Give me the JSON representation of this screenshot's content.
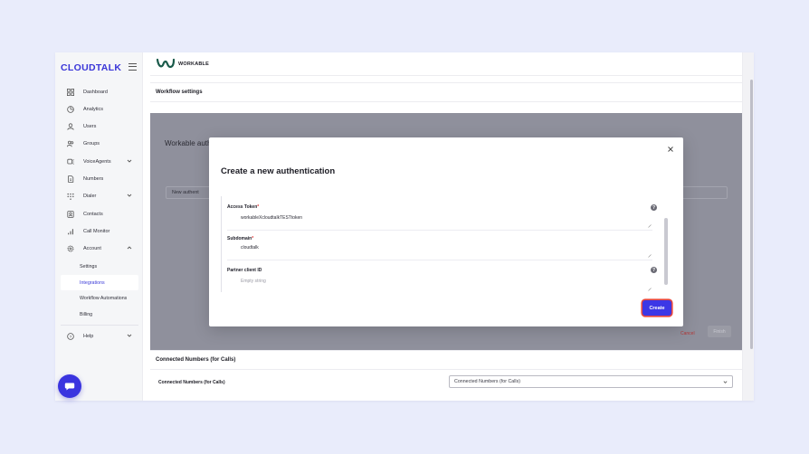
{
  "sidebar": {
    "logo": "CLOUDTALK",
    "items": [
      {
        "label": "Dashboard",
        "icon": "grid-icon"
      },
      {
        "label": "Analytics",
        "icon": "pie-chart-icon"
      },
      {
        "label": "Users",
        "icon": "user-icon"
      },
      {
        "label": "Groups",
        "icon": "users-icon"
      },
      {
        "label": "VoiceAgents",
        "icon": "voice-agent-icon",
        "expandable": true
      },
      {
        "label": "Numbers",
        "icon": "number-doc-icon"
      },
      {
        "label": "Dialer",
        "icon": "dialpad-icon",
        "expandable": true
      },
      {
        "label": "Contacts",
        "icon": "contact-card-icon"
      },
      {
        "label": "Call Monitor",
        "icon": "bar-chart-icon"
      },
      {
        "label": "Account",
        "icon": "gear-icon",
        "expanded": true
      }
    ],
    "account_sub": [
      "Settings",
      "Integrations",
      "Workflow Automations",
      "Billing"
    ],
    "active_sub": "Integrations",
    "help": "Help"
  },
  "main": {
    "integration_name": "WORKABLE",
    "workflow_settings": "Workflow settings",
    "background_heading": "Workable auth",
    "background_select": "New authent",
    "cancel": "Cancel",
    "finish": "Finish",
    "connected_section": "Connected Numbers (for Calls)",
    "connected_label": "Connected Numbers (for Calls)",
    "connected_select": "Connected Numbers (for Calls)"
  },
  "modal": {
    "title": "Create a new authentication",
    "fields": [
      {
        "label": "Access Token",
        "required": "*",
        "value": "workableXcloudtalkTESTtoken"
      },
      {
        "label": "Subdomain",
        "required": "*",
        "value": "cloudtalk"
      },
      {
        "label": "Partner client ID",
        "required": "",
        "placeholder": "Empty string"
      }
    ],
    "help_glyph": "?",
    "create": "Create"
  },
  "colors": {
    "brand": "#3a36d8",
    "create_button": "#3c37e6",
    "create_outline": "#e8473d",
    "overlay": "#8f909c",
    "cancel": "#b33636"
  }
}
